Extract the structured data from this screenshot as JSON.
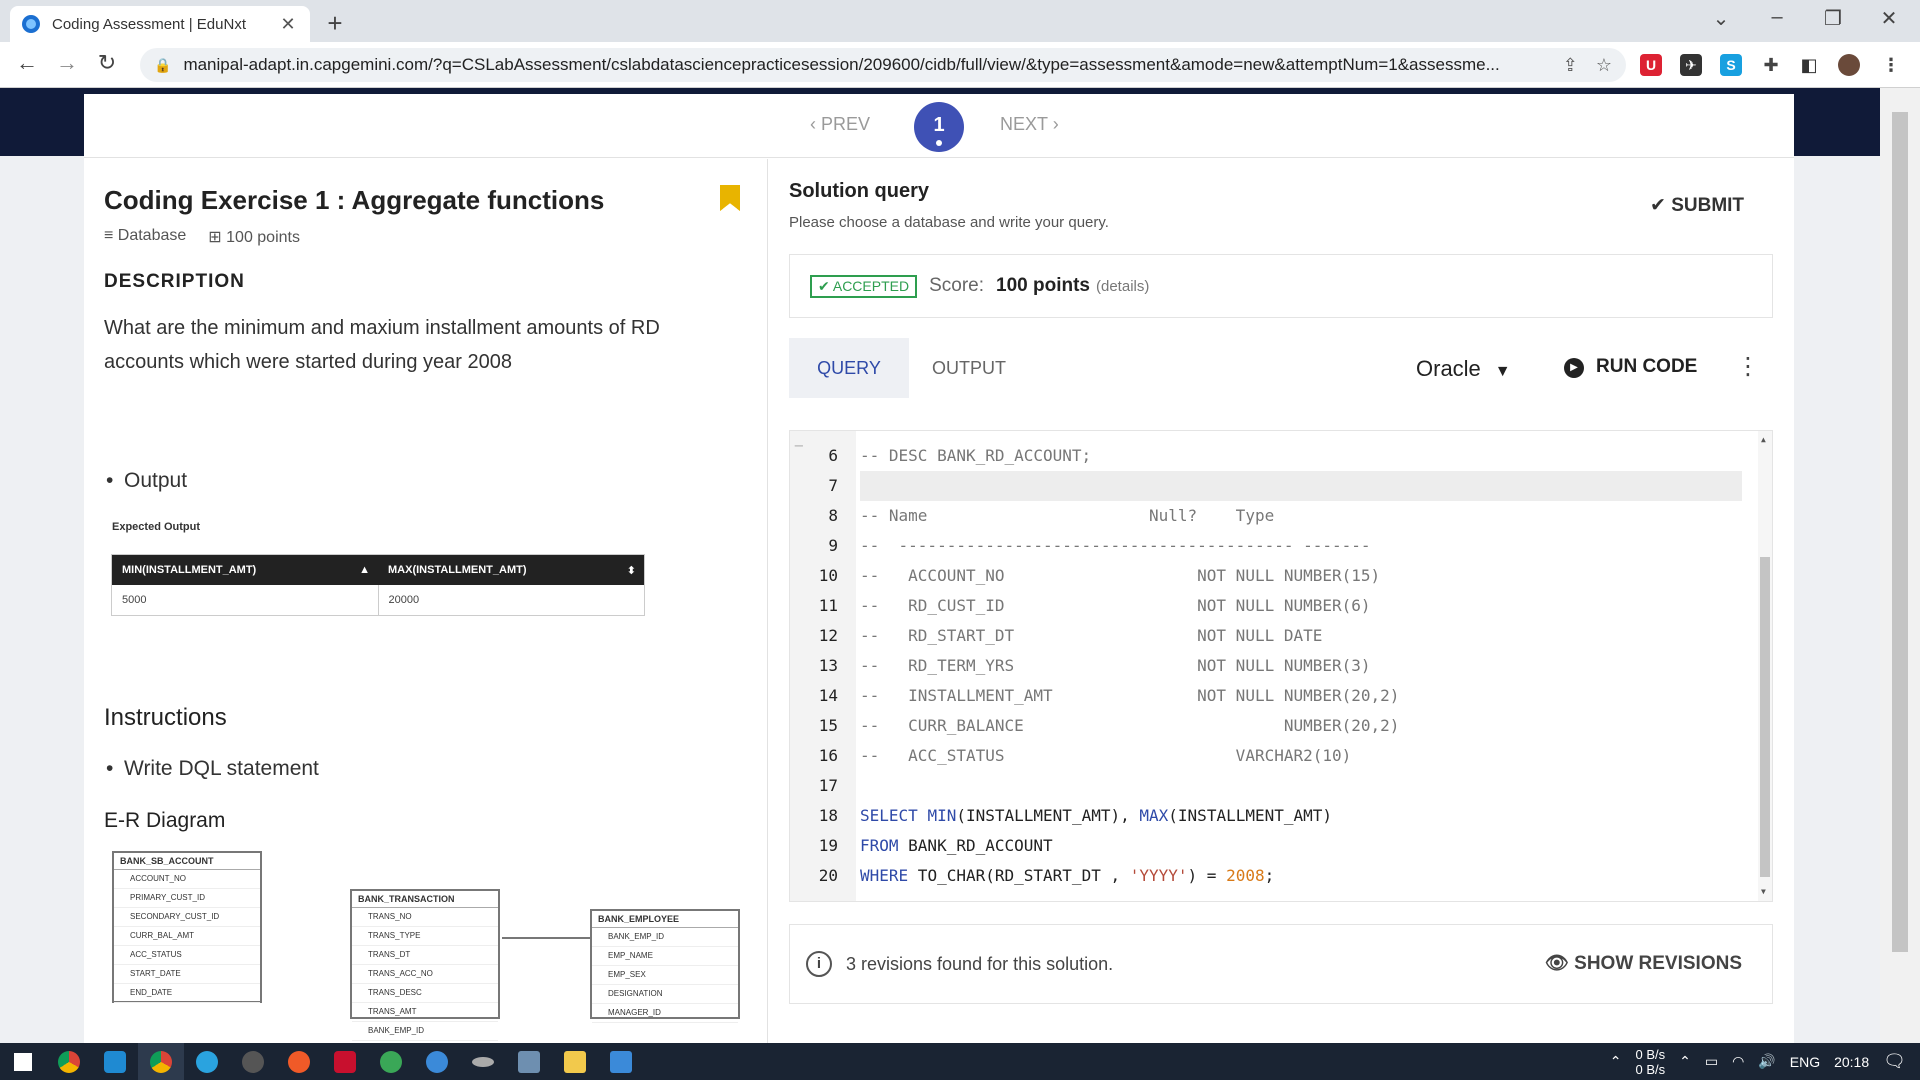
{
  "browser": {
    "tab_title": "Coding Assessment | EduNxt",
    "url": "manipal-adapt.in.capgemini.com/?q=CSLabAssessment/cslabdatasciencepracticesession/209600/cidb/full/view/&type=assessment&amode=new&attemptNum=1&assessme..."
  },
  "question_nav": {
    "prev": "PREV",
    "current": "1",
    "next": "NEXT"
  },
  "exercise": {
    "title": "Coding Exercise 1 : Aggregate functions",
    "category": "Database",
    "points": "100 points",
    "description_heading": "DESCRIPTION",
    "description": "What are the minimum and maxium installment amounts of RD accounts which were started during year 2008",
    "output_bullet": "Output",
    "expected_output_label": "Expected Output",
    "expected_table": {
      "headers": [
        "MIN(INSTALLMENT_AMT)",
        "MAX(INSTALLMENT_AMT)"
      ],
      "row": [
        "5000",
        "20000"
      ]
    },
    "instructions_heading": "Instructions",
    "instruction": "Write DQL statement",
    "er_heading": "E-R Diagram",
    "er_entities": [
      {
        "name": "BANK_SB_ACCOUNT",
        "fields": [
          "ACCOUNT_NO",
          "PRIMARY_CUST_ID",
          "SECONDARY_CUST_ID",
          "CURR_BAL_AMT",
          "ACC_STATUS",
          "START_DATE",
          "END_DATE"
        ]
      },
      {
        "name": "BANK_TRANSACTION",
        "fields": [
          "TRANS_NO",
          "TRANS_TYPE",
          "TRANS_DT",
          "TRANS_ACC_NO",
          "TRANS_DESC",
          "TRANS_AMT",
          "BANK_EMP_ID"
        ]
      },
      {
        "name": "BANK_EMPLOYEE",
        "fields": [
          "BANK_EMP_ID",
          "EMP_NAME",
          "EMP_SEX",
          "DESIGNATION",
          "MANAGER_ID"
        ]
      }
    ]
  },
  "solution": {
    "title": "Solution query",
    "subtitle": "Please choose a database and write your query.",
    "submit": "SUBMIT",
    "status": "ACCEPTED",
    "score_label": "Score:",
    "score_value": "100 points",
    "details": "(details)",
    "tabs": [
      "QUERY",
      "OUTPUT"
    ],
    "language": "Oracle",
    "run_code": "RUN CODE",
    "revisions_text": "3 revisions found for this solution.",
    "show_revisions": "SHOW REVISIONS"
  },
  "code_lines": [
    {
      "n": "6",
      "t": "-- DESC BANK_RD_ACCOUNT;"
    },
    {
      "n": "7",
      "t": ""
    },
    {
      "n": "8",
      "t": "-- Name                       Null?    Type"
    },
    {
      "n": "9",
      "t": "--  ----------------------------------------- -------"
    },
    {
      "n": "10",
      "t": "--   ACCOUNT_NO                    NOT NULL NUMBER(15)"
    },
    {
      "n": "11",
      "t": "--   RD_CUST_ID                    NOT NULL NUMBER(6)"
    },
    {
      "n": "12",
      "t": "--   RD_START_DT                   NOT NULL DATE"
    },
    {
      "n": "13",
      "t": "--   RD_TERM_YRS                   NOT NULL NUMBER(3)"
    },
    {
      "n": "14",
      "t": "--   INSTALLMENT_AMT               NOT NULL NUMBER(20,2)"
    },
    {
      "n": "15",
      "t": "--   CURR_BALANCE                           NUMBER(20,2)"
    },
    {
      "n": "16",
      "t": "--   ACC_STATUS                        VARCHAR2(10)"
    },
    {
      "n": "17",
      "t": ""
    },
    {
      "n": "18",
      "t": "SELECT MIN(INSTALLMENT_AMT), MAX(INSTALLMENT_AMT)"
    },
    {
      "n": "19",
      "t": "FROM BANK_RD_ACCOUNT"
    },
    {
      "n": "20",
      "t": "WHERE TO_CHAR(RD_START_DT , 'YYYY') = 2008;"
    }
  ],
  "taskbar": {
    "net_up": "0 B/s",
    "net_down": "0 B/s",
    "lang": "ENG",
    "time": "20:18"
  }
}
